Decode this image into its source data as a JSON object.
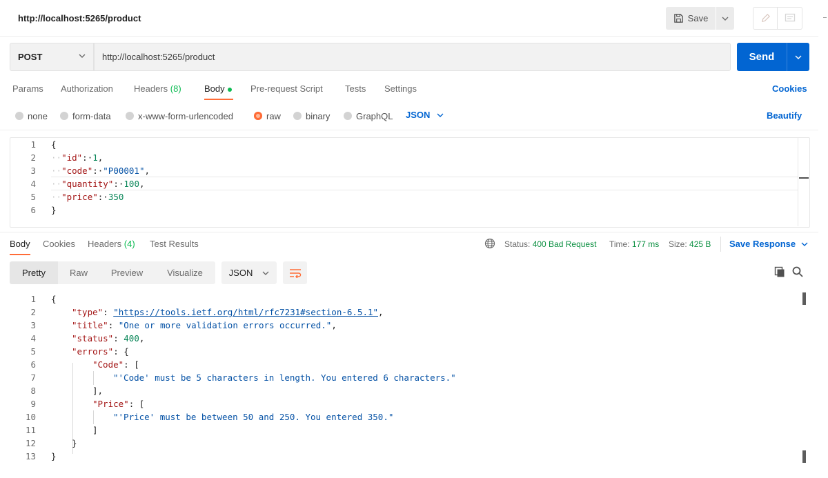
{
  "header": {
    "title": "http://localhost:5265/product",
    "save_label": "Save"
  },
  "request": {
    "method": "POST",
    "url": "http://localhost:5265/product",
    "send_label": "Send",
    "tabs": {
      "params": "Params",
      "authorization": "Authorization",
      "headers": "Headers",
      "headers_count": "(8)",
      "body": "Body",
      "prerequest": "Pre-request Script",
      "tests": "Tests",
      "settings": "Settings",
      "cookies": "Cookies"
    },
    "body_types": {
      "none": "none",
      "form_data": "form-data",
      "urlencoded": "x-www-form-urlencoded",
      "raw": "raw",
      "binary": "binary",
      "graphql": "GraphQL",
      "format": "JSON",
      "beautify": "Beautify"
    },
    "body_lines": [
      {
        "n": "1",
        "text": "{"
      },
      {
        "n": "2",
        "key": "\"id\"",
        "value": "1",
        "vtype": "n",
        "comma": ","
      },
      {
        "n": "3",
        "key": "\"code\"",
        "value": "\"P00001\"",
        "vtype": "s",
        "comma": ","
      },
      {
        "n": "4",
        "key": "\"quantity\"",
        "value": "100",
        "vtype": "n",
        "comma": ","
      },
      {
        "n": "5",
        "key": "\"price\"",
        "value": "350",
        "vtype": "n",
        "comma": ""
      },
      {
        "n": "6",
        "text": "}"
      }
    ]
  },
  "response": {
    "tabs": {
      "body": "Body",
      "cookies": "Cookies",
      "headers": "Headers",
      "headers_count": "(4)",
      "test_results": "Test Results"
    },
    "status_label": "Status:",
    "status_value": "400 Bad Request",
    "time_label": "Time:",
    "time_value": "177 ms",
    "size_label": "Size:",
    "size_value": "425 B",
    "save_response": "Save Response",
    "views": {
      "pretty": "Pretty",
      "raw": "Raw",
      "preview": "Preview",
      "visualize": "Visualize",
      "format": "JSON"
    },
    "line_numbers": [
      "1",
      "2",
      "3",
      "4",
      "5",
      "6",
      "7",
      "8",
      "9",
      "10",
      "11",
      "12",
      "13"
    ],
    "type_key": "\"type\"",
    "type_value": "\"https://tools.ietf.org/html/rfc7231#section-6.5.1\"",
    "title_key": "\"title\"",
    "title_value": "\"One or more validation errors occurred.\"",
    "status_key": "\"status\"",
    "status_num": "400",
    "errors_key": "\"errors\"",
    "code_key": "\"Code\"",
    "code_msg": "\"'Code' must be 5 characters in length. You entered 6 characters.\"",
    "price_key": "\"Price\"",
    "price_msg": "\"'Price' must be between 50 and 250. You entered 350.\""
  },
  "colors": {
    "accent_orange": "#ff6c37",
    "primary_blue": "#0265d2",
    "success_green": "#0cbb52"
  }
}
